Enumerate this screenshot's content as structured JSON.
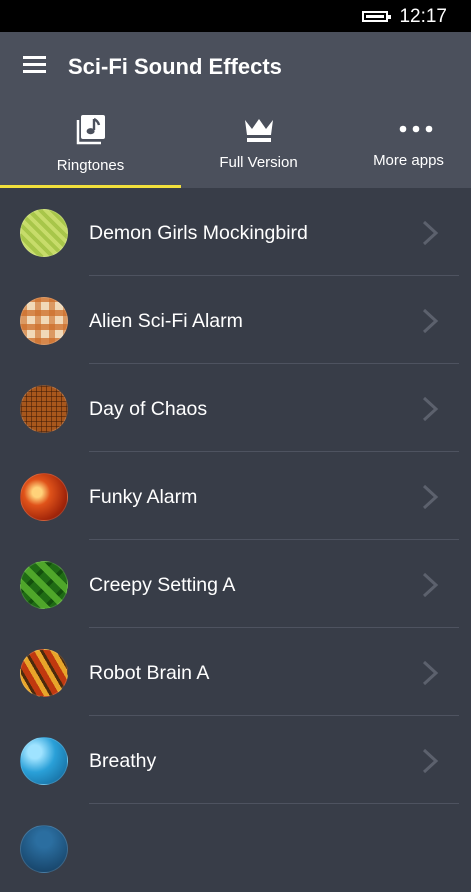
{
  "status_bar": {
    "time": "12:17"
  },
  "header": {
    "title": "Sci-Fi Sound Effects"
  },
  "tabs": [
    {
      "label": "Ringtones",
      "icon": "music-note-icon",
      "active": true
    },
    {
      "label": "Full Version",
      "icon": "crown-icon",
      "active": false
    },
    {
      "label": "More apps",
      "icon": "more-dots-icon",
      "active": false
    }
  ],
  "accent_color": "#f2e03c",
  "ringtones": [
    {
      "name": "Demon Girls Mockingbird",
      "thumb": "green-stripes"
    },
    {
      "name": "Alien Sci-Fi Alarm",
      "thumb": "orange-plaid"
    },
    {
      "name": "Day of Chaos",
      "thumb": "brown-grid"
    },
    {
      "name": "Funky Alarm",
      "thumb": "orange-bubbles"
    },
    {
      "name": "Creepy Setting A",
      "thumb": "green-diamonds"
    },
    {
      "name": "Robot Brain A",
      "thumb": "red-yellow-stripes"
    },
    {
      "name": "Breathy",
      "thumb": "blue-marble"
    },
    {
      "name": "",
      "thumb": "dark-blue"
    }
  ]
}
